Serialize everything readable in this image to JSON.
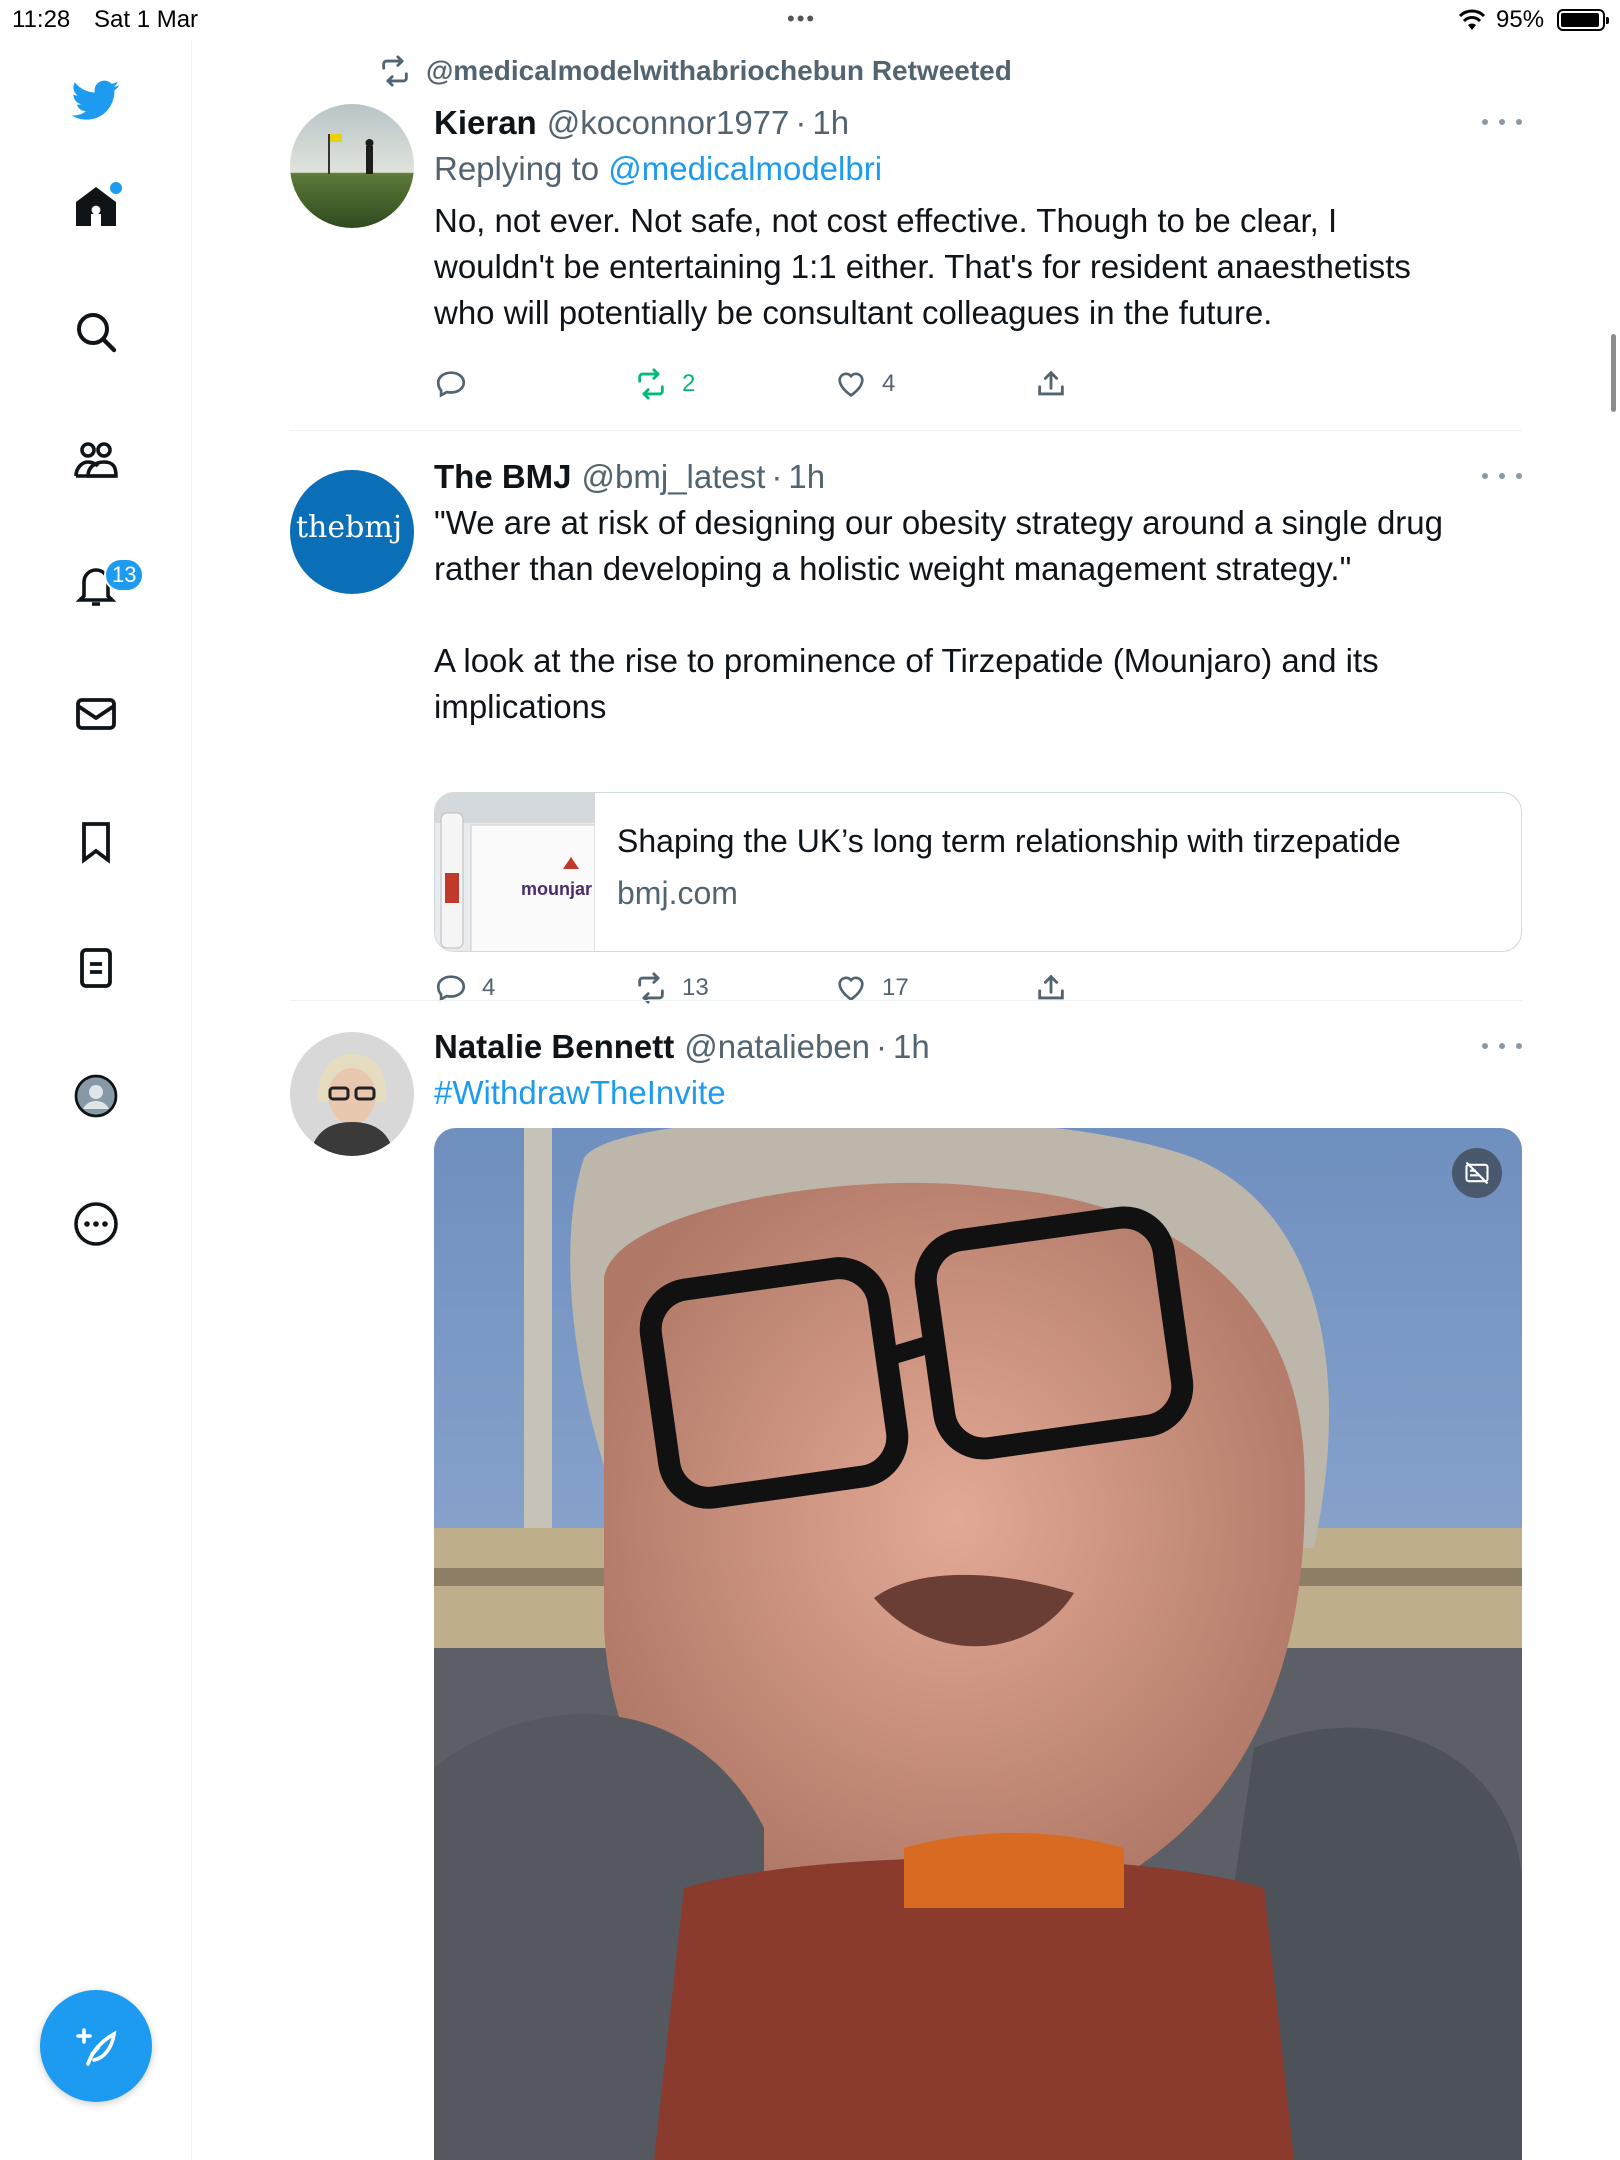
{
  "status_bar": {
    "time": "11:28",
    "date": "Sat 1 Mar",
    "battery": "95%",
    "battery_level": 0.95
  },
  "sidebar": {
    "items": [
      {
        "icon": "twitter-logo-icon",
        "label": ""
      },
      {
        "icon": "home-icon",
        "label": ""
      },
      {
        "icon": "search-icon",
        "label": ""
      },
      {
        "icon": "communities-icon",
        "label": ""
      },
      {
        "icon": "notifications-icon",
        "label": "",
        "badge": "13"
      },
      {
        "icon": "messages-icon",
        "label": ""
      },
      {
        "icon": "bookmarks-icon",
        "label": ""
      },
      {
        "icon": "lists-icon",
        "label": ""
      },
      {
        "icon": "profile-icon",
        "label": ""
      },
      {
        "icon": "more-icon",
        "label": ""
      }
    ],
    "compose_icon": "compose-tweet-icon"
  },
  "colors": {
    "accent": "#1d9bf0",
    "retweet": "#00ba7c",
    "secondary_text": "#536471"
  },
  "feed": {
    "tweets": [
      {
        "social_context": "@medicalmodelwithabriochebun Retweeted",
        "name": "Kieran",
        "handle": "@koconnor1977",
        "sep": "·",
        "time": "1h",
        "replying_prefix": "Replying to ",
        "replying_to": "@medicalmodelbri",
        "text": "No, not ever. Not safe, not cost effective. Though to be clear, I\nwouldn't be entertaining 1:1 either. That's for resident anaesthetists\nwho will potentially be consultant colleagues in the future.",
        "replies": "",
        "retweets": "2",
        "likes": "4"
      },
      {
        "name": "The BMJ",
        "handle": "@bmj_latest",
        "sep": "·",
        "time": "1h",
        "avatar_text": "thebmj",
        "text": "\"We are at risk of designing our obesity strategy around a single drug\nrather than developing a holistic weight management strategy.\"\n\nA look at the rise to prominence of Tirzepatide (Mounjaro) and its\nimplications",
        "link_card": {
          "title": "Shaping the UK’s long term relationship with tirzepatide",
          "domain": "bmj.com",
          "thumb_text": "mounjar"
        },
        "replies": "4",
        "retweets": "13",
        "likes": "17"
      },
      {
        "name": "Natalie Bennett",
        "handle": "@natalieben",
        "sep": "·",
        "time": "1h",
        "hashtag": "#WithdrawTheInvite",
        "media_badge_icon": "sensitive-media-icon"
      }
    ]
  }
}
